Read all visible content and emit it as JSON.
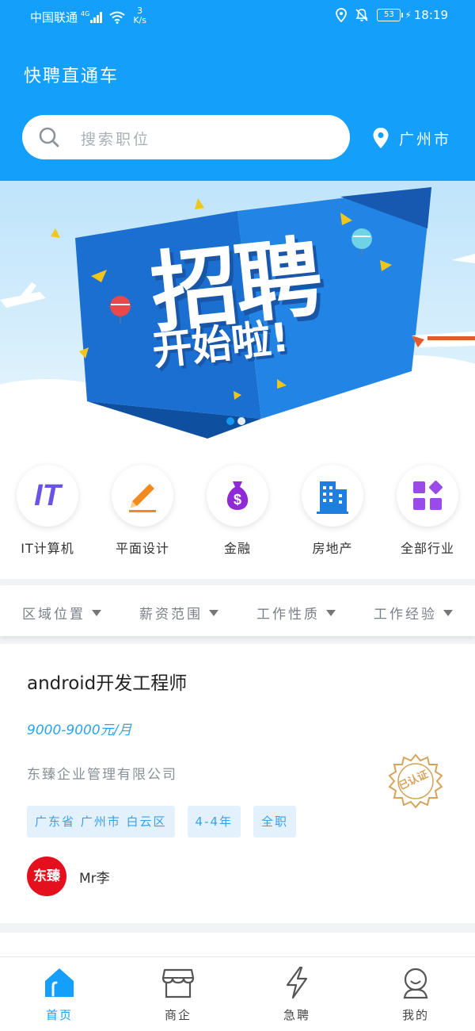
{
  "status_bar": {
    "carrier": "中国联通",
    "network": "4G",
    "speed_value": "3",
    "speed_unit": "K/s",
    "battery": "53",
    "time": "18:19"
  },
  "header": {
    "app_title": "快聘直通车",
    "search_placeholder": "搜索职位",
    "city": "广州市"
  },
  "banner": {
    "headline": "招聘",
    "subline": "开始啦!",
    "slide_count": 2,
    "active_slide": 1
  },
  "categories": [
    {
      "label": "IT计算机",
      "icon": "it-icon",
      "icon_text": "IT"
    },
    {
      "label": "平面设计",
      "icon": "pencil-icon"
    },
    {
      "label": "金融",
      "icon": "money-bag-icon"
    },
    {
      "label": "房地产",
      "icon": "building-icon"
    },
    {
      "label": "全部行业",
      "icon": "grid-icon"
    }
  ],
  "filters": [
    {
      "label": "区域位置"
    },
    {
      "label": "薪资范围"
    },
    {
      "label": "工作性质"
    },
    {
      "label": "工作经验"
    }
  ],
  "job": {
    "title": "android开发工程师",
    "salary": "9000-9000元/月",
    "company": "东臻企业管理有限公司",
    "verified_stamp": "已认证",
    "tags": [
      "广东省 广州市 白云区",
      "4-4年",
      "全职"
    ],
    "recruiter_logo_text": "东臻",
    "recruiter_name": "Mr李"
  },
  "bottom_nav": [
    {
      "label": "首页",
      "icon": "home-icon",
      "active": true
    },
    {
      "label": "商企",
      "icon": "shop-icon",
      "active": false
    },
    {
      "label": "急聘",
      "icon": "lightning-icon",
      "active": false
    },
    {
      "label": "我的",
      "icon": "profile-icon",
      "active": false
    }
  ],
  "colors": {
    "primary": "#14a0fa",
    "tag_bg": "#e3f1fd",
    "tag_text": "#3aa0e8",
    "salary": "#2aa3f0",
    "recruiter_logo": "#e5101d",
    "verified_stamp": "#d4a45a"
  }
}
